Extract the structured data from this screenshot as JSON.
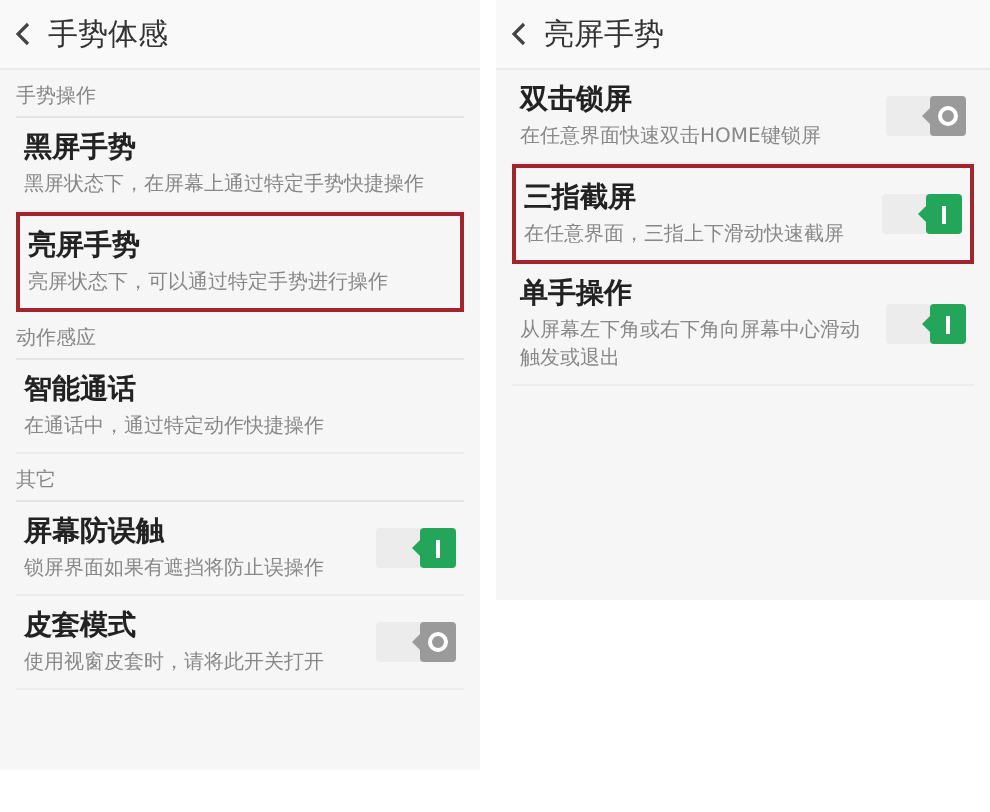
{
  "panels": [
    {
      "title": "手势体感",
      "sections": [
        {
          "label": "手势操作",
          "items": [
            {
              "kind": "link",
              "title": "黑屏手势",
              "description": "黑屏状态下，在屏幕上通过特定手势快捷操作",
              "highlighted": false
            },
            {
              "kind": "link",
              "title": "亮屏手势",
              "description": "亮屏状态下，可以通过特定手势进行操作",
              "highlighted": true
            }
          ]
        },
        {
          "label": "动作感应",
          "items": [
            {
              "kind": "link",
              "title": "智能通话",
              "description": "在通话中，通过特定动作快捷操作",
              "highlighted": false
            }
          ]
        },
        {
          "label": "其它",
          "items": [
            {
              "kind": "toggle",
              "title": "屏幕防误触",
              "description": "锁屏界面如果有遮挡将防止误操作",
              "on": true,
              "highlighted": false
            },
            {
              "kind": "toggle",
              "title": "皮套模式",
              "description": "使用视窗皮套时，请将此开关打开",
              "on": false,
              "highlighted": false
            }
          ]
        }
      ]
    },
    {
      "title": "亮屏手势",
      "sections": [
        {
          "items": [
            {
              "kind": "toggle",
              "title": "双击锁屏",
              "description": "在任意界面快速双击HOME键锁屏",
              "on": false,
              "highlighted": false
            },
            {
              "kind": "toggle",
              "title": "三指截屏",
              "description": "在任意界面，三指上下滑动快速截屏",
              "on": true,
              "highlighted": true
            },
            {
              "kind": "toggle",
              "title": "单手操作",
              "description": "从屏幕左下角或右下角向屏幕中心滑动触发或退出",
              "on": true,
              "highlighted": false
            }
          ]
        }
      ]
    }
  ]
}
